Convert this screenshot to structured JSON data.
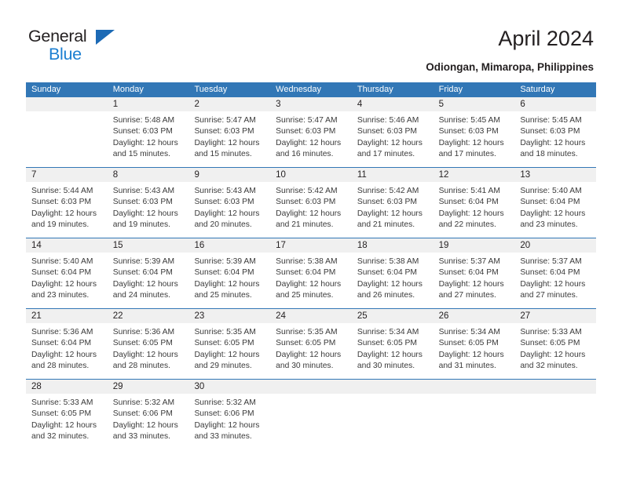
{
  "brand": {
    "name_part1": "General",
    "name_part2": "Blue",
    "accent_color": "#1c7fd1",
    "triangle_color": "#1c6ab5",
    "logo_icon": "blue-triangle-icon"
  },
  "header": {
    "title": "April 2024",
    "subtitle": "Odiongan, Mimaropa, Philippines"
  },
  "theme": {
    "header_blue": "#3277b6",
    "day_number_bg": "#f0f0f0",
    "text_color": "#231f20"
  },
  "calendar": {
    "weekdays": [
      "Sunday",
      "Monday",
      "Tuesday",
      "Wednesday",
      "Thursday",
      "Friday",
      "Saturday"
    ],
    "weeks": [
      [
        {
          "day": "",
          "sunrise": "",
          "sunset": "",
          "daylight_1": "",
          "daylight_2": ""
        },
        {
          "day": "1",
          "sunrise": "Sunrise: 5:48 AM",
          "sunset": "Sunset: 6:03 PM",
          "daylight_1": "Daylight: 12 hours",
          "daylight_2": "and 15 minutes."
        },
        {
          "day": "2",
          "sunrise": "Sunrise: 5:47 AM",
          "sunset": "Sunset: 6:03 PM",
          "daylight_1": "Daylight: 12 hours",
          "daylight_2": "and 15 minutes."
        },
        {
          "day": "3",
          "sunrise": "Sunrise: 5:47 AM",
          "sunset": "Sunset: 6:03 PM",
          "daylight_1": "Daylight: 12 hours",
          "daylight_2": "and 16 minutes."
        },
        {
          "day": "4",
          "sunrise": "Sunrise: 5:46 AM",
          "sunset": "Sunset: 6:03 PM",
          "daylight_1": "Daylight: 12 hours",
          "daylight_2": "and 17 minutes."
        },
        {
          "day": "5",
          "sunrise": "Sunrise: 5:45 AM",
          "sunset": "Sunset: 6:03 PM",
          "daylight_1": "Daylight: 12 hours",
          "daylight_2": "and 17 minutes."
        },
        {
          "day": "6",
          "sunrise": "Sunrise: 5:45 AM",
          "sunset": "Sunset: 6:03 PM",
          "daylight_1": "Daylight: 12 hours",
          "daylight_2": "and 18 minutes."
        }
      ],
      [
        {
          "day": "7",
          "sunrise": "Sunrise: 5:44 AM",
          "sunset": "Sunset: 6:03 PM",
          "daylight_1": "Daylight: 12 hours",
          "daylight_2": "and 19 minutes."
        },
        {
          "day": "8",
          "sunrise": "Sunrise: 5:43 AM",
          "sunset": "Sunset: 6:03 PM",
          "daylight_1": "Daylight: 12 hours",
          "daylight_2": "and 19 minutes."
        },
        {
          "day": "9",
          "sunrise": "Sunrise: 5:43 AM",
          "sunset": "Sunset: 6:03 PM",
          "daylight_1": "Daylight: 12 hours",
          "daylight_2": "and 20 minutes."
        },
        {
          "day": "10",
          "sunrise": "Sunrise: 5:42 AM",
          "sunset": "Sunset: 6:03 PM",
          "daylight_1": "Daylight: 12 hours",
          "daylight_2": "and 21 minutes."
        },
        {
          "day": "11",
          "sunrise": "Sunrise: 5:42 AM",
          "sunset": "Sunset: 6:03 PM",
          "daylight_1": "Daylight: 12 hours",
          "daylight_2": "and 21 minutes."
        },
        {
          "day": "12",
          "sunrise": "Sunrise: 5:41 AM",
          "sunset": "Sunset: 6:04 PM",
          "daylight_1": "Daylight: 12 hours",
          "daylight_2": "and 22 minutes."
        },
        {
          "day": "13",
          "sunrise": "Sunrise: 5:40 AM",
          "sunset": "Sunset: 6:04 PM",
          "daylight_1": "Daylight: 12 hours",
          "daylight_2": "and 23 minutes."
        }
      ],
      [
        {
          "day": "14",
          "sunrise": "Sunrise: 5:40 AM",
          "sunset": "Sunset: 6:04 PM",
          "daylight_1": "Daylight: 12 hours",
          "daylight_2": "and 23 minutes."
        },
        {
          "day": "15",
          "sunrise": "Sunrise: 5:39 AM",
          "sunset": "Sunset: 6:04 PM",
          "daylight_1": "Daylight: 12 hours",
          "daylight_2": "and 24 minutes."
        },
        {
          "day": "16",
          "sunrise": "Sunrise: 5:39 AM",
          "sunset": "Sunset: 6:04 PM",
          "daylight_1": "Daylight: 12 hours",
          "daylight_2": "and 25 minutes."
        },
        {
          "day": "17",
          "sunrise": "Sunrise: 5:38 AM",
          "sunset": "Sunset: 6:04 PM",
          "daylight_1": "Daylight: 12 hours",
          "daylight_2": "and 25 minutes."
        },
        {
          "day": "18",
          "sunrise": "Sunrise: 5:38 AM",
          "sunset": "Sunset: 6:04 PM",
          "daylight_1": "Daylight: 12 hours",
          "daylight_2": "and 26 minutes."
        },
        {
          "day": "19",
          "sunrise": "Sunrise: 5:37 AM",
          "sunset": "Sunset: 6:04 PM",
          "daylight_1": "Daylight: 12 hours",
          "daylight_2": "and 27 minutes."
        },
        {
          "day": "20",
          "sunrise": "Sunrise: 5:37 AM",
          "sunset": "Sunset: 6:04 PM",
          "daylight_1": "Daylight: 12 hours",
          "daylight_2": "and 27 minutes."
        }
      ],
      [
        {
          "day": "21",
          "sunrise": "Sunrise: 5:36 AM",
          "sunset": "Sunset: 6:04 PM",
          "daylight_1": "Daylight: 12 hours",
          "daylight_2": "and 28 minutes."
        },
        {
          "day": "22",
          "sunrise": "Sunrise: 5:36 AM",
          "sunset": "Sunset: 6:05 PM",
          "daylight_1": "Daylight: 12 hours",
          "daylight_2": "and 28 minutes."
        },
        {
          "day": "23",
          "sunrise": "Sunrise: 5:35 AM",
          "sunset": "Sunset: 6:05 PM",
          "daylight_1": "Daylight: 12 hours",
          "daylight_2": "and 29 minutes."
        },
        {
          "day": "24",
          "sunrise": "Sunrise: 5:35 AM",
          "sunset": "Sunset: 6:05 PM",
          "daylight_1": "Daylight: 12 hours",
          "daylight_2": "and 30 minutes."
        },
        {
          "day": "25",
          "sunrise": "Sunrise: 5:34 AM",
          "sunset": "Sunset: 6:05 PM",
          "daylight_1": "Daylight: 12 hours",
          "daylight_2": "and 30 minutes."
        },
        {
          "day": "26",
          "sunrise": "Sunrise: 5:34 AM",
          "sunset": "Sunset: 6:05 PM",
          "daylight_1": "Daylight: 12 hours",
          "daylight_2": "and 31 minutes."
        },
        {
          "day": "27",
          "sunrise": "Sunrise: 5:33 AM",
          "sunset": "Sunset: 6:05 PM",
          "daylight_1": "Daylight: 12 hours",
          "daylight_2": "and 32 minutes."
        }
      ],
      [
        {
          "day": "28",
          "sunrise": "Sunrise: 5:33 AM",
          "sunset": "Sunset: 6:05 PM",
          "daylight_1": "Daylight: 12 hours",
          "daylight_2": "and 32 minutes."
        },
        {
          "day": "29",
          "sunrise": "Sunrise: 5:32 AM",
          "sunset": "Sunset: 6:06 PM",
          "daylight_1": "Daylight: 12 hours",
          "daylight_2": "and 33 minutes."
        },
        {
          "day": "30",
          "sunrise": "Sunrise: 5:32 AM",
          "sunset": "Sunset: 6:06 PM",
          "daylight_1": "Daylight: 12 hours",
          "daylight_2": "and 33 minutes."
        },
        {
          "day": "",
          "sunrise": "",
          "sunset": "",
          "daylight_1": "",
          "daylight_2": ""
        },
        {
          "day": "",
          "sunrise": "",
          "sunset": "",
          "daylight_1": "",
          "daylight_2": ""
        },
        {
          "day": "",
          "sunrise": "",
          "sunset": "",
          "daylight_1": "",
          "daylight_2": ""
        },
        {
          "day": "",
          "sunrise": "",
          "sunset": "",
          "daylight_1": "",
          "daylight_2": ""
        }
      ]
    ]
  }
}
